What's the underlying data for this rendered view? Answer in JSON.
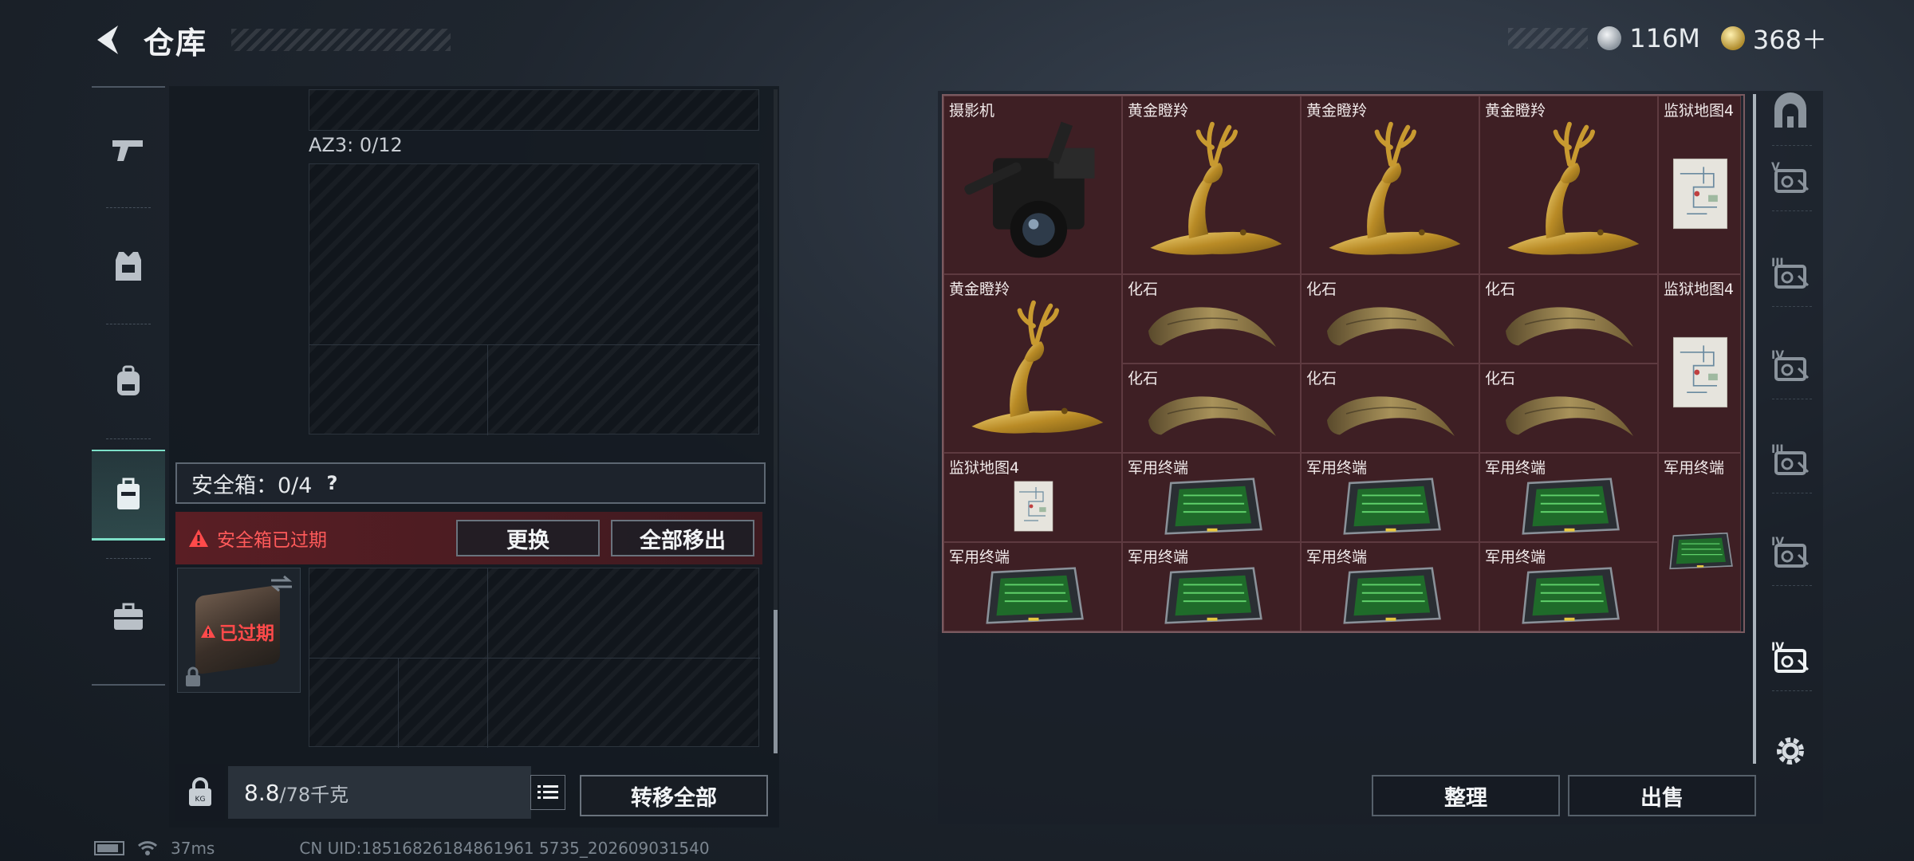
{
  "header": {
    "title": "仓库",
    "currencies": [
      {
        "icon": "silver-coin-icon",
        "value": "116M"
      },
      {
        "icon": "gold-coin-icon",
        "value": "368＋"
      }
    ]
  },
  "sidebar": {
    "items": [
      {
        "name": "weapons",
        "icon": "pistol-icon"
      },
      {
        "name": "armor",
        "icon": "armor-vest-icon"
      },
      {
        "name": "backpack",
        "icon": "backpack-icon"
      },
      {
        "name": "safebox",
        "icon": "safebox-icon",
        "active": true
      },
      {
        "name": "supplies",
        "icon": "briefcase-icon"
      }
    ]
  },
  "container": {
    "slot_label": "AZ3: 0/12",
    "safe_label": "安全箱：0/4",
    "help": "?",
    "expired_warning": "安全箱已过期",
    "replace_button": "更换",
    "remove_all_button": "全部移出",
    "safebox_expired": "已过期",
    "weight_value": "8.8",
    "weight_unit": "/78千克",
    "transfer_all_button": "转移全部"
  },
  "status_bar": {
    "ping": "37ms",
    "uid": "CN UID:18516826184861961 5735_202609031540"
  },
  "stash": {
    "items": [
      {
        "name": "摄影机",
        "kind": "camera"
      },
      {
        "name": "黄金瞪羚",
        "kind": "gazelle"
      },
      {
        "name": "黄金瞪羚",
        "kind": "gazelle"
      },
      {
        "name": "黄金瞪羚",
        "kind": "gazelle"
      },
      {
        "name": "监狱地图4",
        "kind": "map"
      },
      {
        "name": "黄金瞪羚",
        "kind": "gazelle"
      },
      {
        "name": "化石",
        "kind": "fossil"
      },
      {
        "name": "化石",
        "kind": "fossil"
      },
      {
        "name": "化石",
        "kind": "fossil"
      },
      {
        "name": "监狱地图4",
        "kind": "map"
      },
      {
        "name": "化石",
        "kind": "fossil"
      },
      {
        "name": "化石",
        "kind": "fossil"
      },
      {
        "name": "化石",
        "kind": "fossil"
      },
      {
        "name": "监狱地图4",
        "kind": "map"
      },
      {
        "name": "军用终端",
        "kind": "terminal"
      },
      {
        "name": "军用终端",
        "kind": "terminal"
      },
      {
        "name": "军用终端",
        "kind": "terminal"
      },
      {
        "name": "军用终端",
        "kind": "terminal"
      },
      {
        "name": "军用终端",
        "kind": "terminal"
      },
      {
        "name": "军用终端",
        "kind": "terminal"
      },
      {
        "name": "军用终端",
        "kind": "terminal"
      },
      {
        "name": "军用终端",
        "kind": "terminal"
      }
    ],
    "sort_button": "整理",
    "sell_button": "出售"
  },
  "right_tabs": [
    {
      "icon": "stash-arch-icon"
    },
    {
      "icon": "stash-v-icon",
      "numeral": "V"
    },
    {
      "icon": "stash-iii-icon",
      "numeral": "III"
    },
    {
      "icon": "stash-iv-icon",
      "numeral": "IV"
    },
    {
      "icon": "stash-iii-b-icon",
      "numeral": "III"
    },
    {
      "icon": "stash-iv-b-icon",
      "numeral": "IV"
    },
    {
      "icon": "stash-iv-active-icon",
      "numeral": "IV",
      "active": true
    },
    {
      "icon": "settings-gear-icon"
    }
  ],
  "colors": {
    "accent": "#7de0c8",
    "warning": "#ff4a4a",
    "cell_bg": "#3e1f24"
  }
}
